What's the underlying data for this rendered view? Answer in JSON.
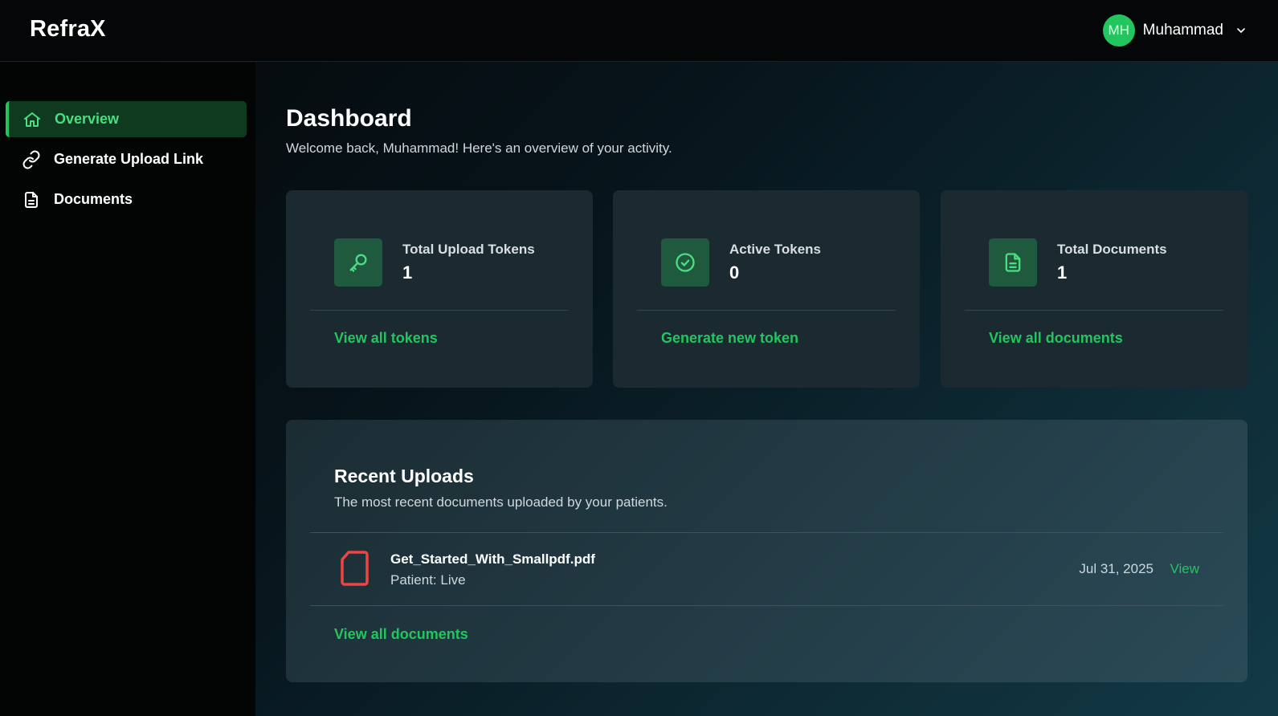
{
  "header": {
    "logo": "RefraX",
    "user": {
      "initials": "MH",
      "name": "Muhammad",
      "avatar_color": "#22c55e"
    },
    "chevron_icon": "chevron-down-icon"
  },
  "sidebar": {
    "items": [
      {
        "label": "Overview",
        "icon": "home-icon",
        "active": true
      },
      {
        "label": "Generate Upload Link",
        "icon": "link-icon",
        "active": false
      },
      {
        "label": "Documents",
        "icon": "document-icon",
        "active": false
      }
    ]
  },
  "main": {
    "title": "Dashboard",
    "subtitle": "Welcome back, Muhammad! Here's an overview of your activity.",
    "stats": [
      {
        "label": "Total Upload Tokens",
        "value": "1",
        "link": "View all tokens",
        "icon": "key-icon"
      },
      {
        "label": "Active Tokens",
        "value": "0",
        "link": "Generate new token",
        "icon": "check-circle-icon"
      },
      {
        "label": "Total Documents",
        "value": "1",
        "link": "View all documents",
        "icon": "document-icon"
      }
    ],
    "recent": {
      "title": "Recent Uploads",
      "subtitle": "The most recent documents uploaded by your patients.",
      "items": [
        {
          "name": "Get_Started_With_Smallpdf.pdf",
          "patient": "Patient: Live",
          "date": "Jul 31, 2025",
          "action": "View",
          "icon": "pdf-file-icon"
        }
      ],
      "view_all": "View all documents"
    }
  },
  "colors": {
    "accent": "#22c55e",
    "pdf_icon": "#ef4444",
    "active_nav_bg": "#0f3a1f"
  }
}
